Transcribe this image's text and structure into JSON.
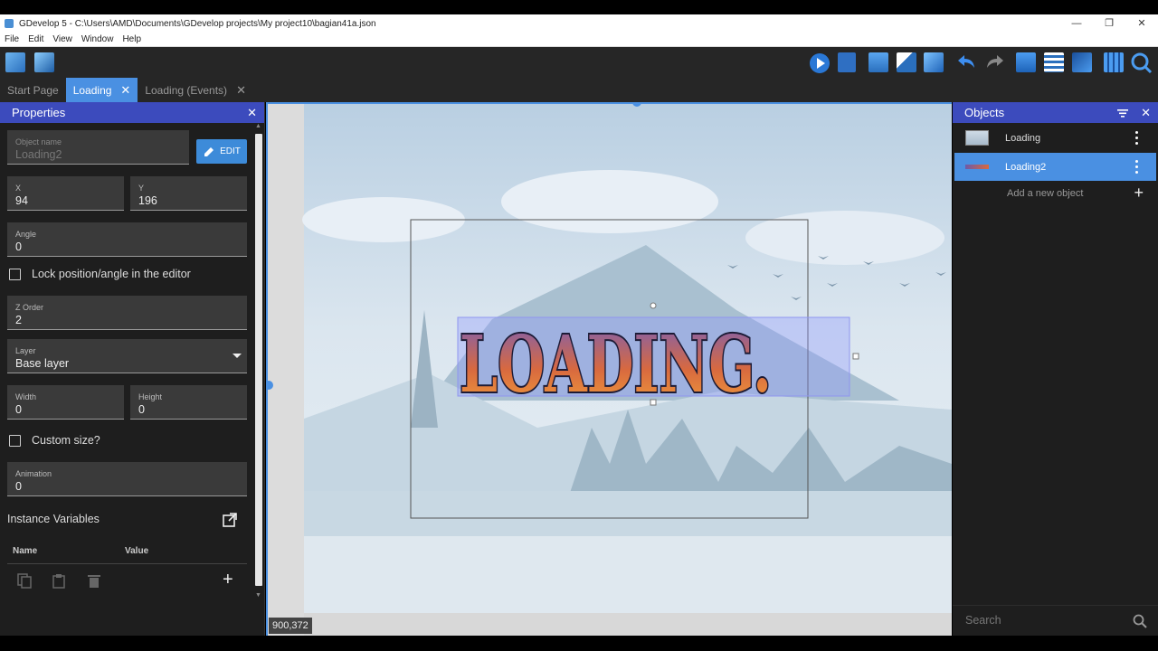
{
  "window": {
    "title": "GDevelop 5 - C:\\Users\\AMD\\Documents\\GDevelop projects\\My project10\\bagian41a.json",
    "controls": [
      "—",
      "❐",
      "✕"
    ]
  },
  "menu": [
    "File",
    "Edit",
    "View",
    "Window",
    "Help"
  ],
  "tabs": [
    {
      "label": "Start Page",
      "closable": false,
      "active": false
    },
    {
      "label": "Loading",
      "closable": true,
      "active": true
    },
    {
      "label": "Loading (Events)",
      "closable": true,
      "active": false
    }
  ],
  "properties": {
    "title": "Properties",
    "object_name_label": "Object name",
    "object_name_value": "Loading2",
    "edit_label": "EDIT",
    "x_label": "X",
    "x_value": "94",
    "y_label": "Y",
    "y_value": "196",
    "angle_label": "Angle",
    "angle_value": "0",
    "lock_label": "Lock position/angle in the editor",
    "zorder_label": "Z Order",
    "zorder_value": "2",
    "layer_label": "Layer",
    "layer_value": "Base layer",
    "width_label": "Width",
    "width_value": "0",
    "height_label": "Height",
    "height_value": "0",
    "custom_size_label": "Custom size?",
    "animation_label": "Animation",
    "animation_value": "0",
    "instance_vars_label": "Instance Variables",
    "col_name": "Name",
    "col_value": "Value"
  },
  "canvas": {
    "text": "LOADING.",
    "coords": "900,372"
  },
  "objects": {
    "title": "Objects",
    "items": [
      {
        "name": "Loading",
        "selected": false
      },
      {
        "name": "Loading2",
        "selected": true
      }
    ],
    "add_label": "Add a new object",
    "search_placeholder": "Search"
  },
  "colors": {
    "accent": "#4a90e2",
    "panel_header": "#3c4bbd",
    "panel_bg": "#1e1e1e"
  }
}
